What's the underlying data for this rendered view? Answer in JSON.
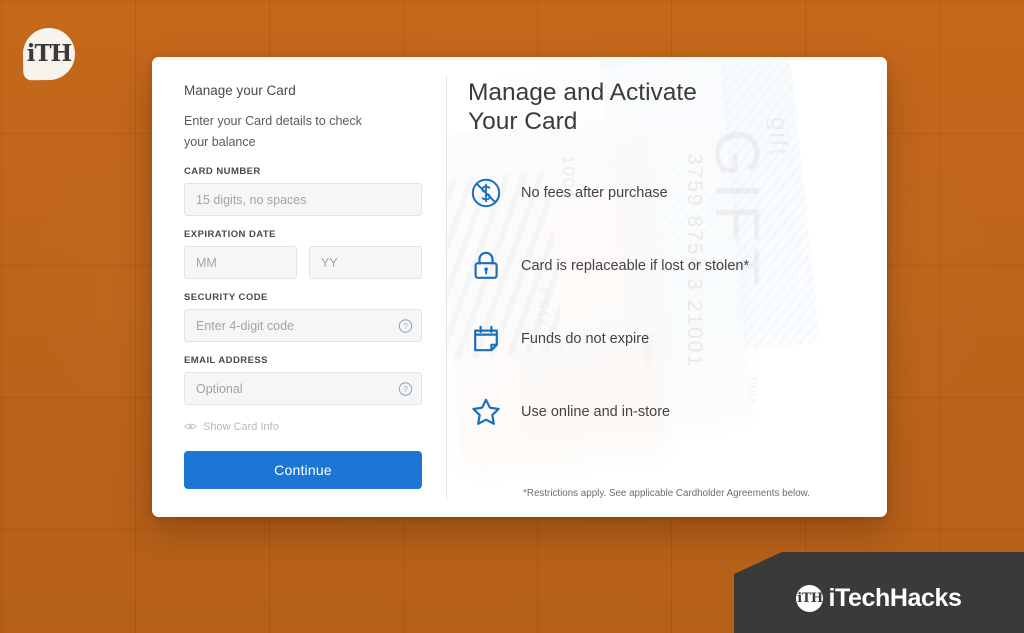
{
  "site": {
    "logo_text": "iTH"
  },
  "form": {
    "title": "Manage your Card",
    "subtitle": "Enter your Card details to check your balance",
    "card_number": {
      "label": "CARD NUMBER",
      "placeholder": "15 digits, no spaces",
      "value": ""
    },
    "expiration": {
      "label": "EXPIRATION DATE",
      "month_placeholder": "MM",
      "month_value": "",
      "year_placeholder": "YY",
      "year_value": ""
    },
    "security_code": {
      "label": "SECURITY CODE",
      "placeholder": "Enter 4-digit code",
      "value": "",
      "help_icon": "question-circle-icon"
    },
    "email": {
      "label": "EMAIL ADDRESS",
      "placeholder": "Optional",
      "value": "",
      "help_icon": "question-circle-icon"
    },
    "show_card_info": {
      "label": "Show Card Info",
      "icon": "eye-icon"
    },
    "submit_label": "Continue"
  },
  "promo": {
    "heading": "Manage and Activate\nYour Card",
    "features": [
      {
        "icon": "no-fee-circle-icon",
        "text": "No fees after purchase"
      },
      {
        "icon": "lock-icon",
        "text": "Card is replaceable if lost or stolen*"
      },
      {
        "icon": "calendar-icon",
        "text": "Funds do not expire"
      },
      {
        "icon": "star-icon",
        "text": "Use online and in-store"
      }
    ],
    "disclaimer": "*Restrictions apply. See applicable Cardholder Agreements below.",
    "artwork": {
      "gift_big": "GIFT",
      "gift_small": "gift",
      "number_1": "3759  8754 3  21001",
      "number_2": "1001",
      "number_3": "8 543",
      "number_4": "7997",
      "number_5": "00/00"
    }
  },
  "watermark": {
    "badge_text": "iTH",
    "text": "iTechHacks"
  },
  "colors": {
    "background_orange": "#c96a1c",
    "accent_blue": "#1b77d3",
    "icon_blue": "#1a6fba",
    "watermark_dark": "#3a3a3a"
  }
}
